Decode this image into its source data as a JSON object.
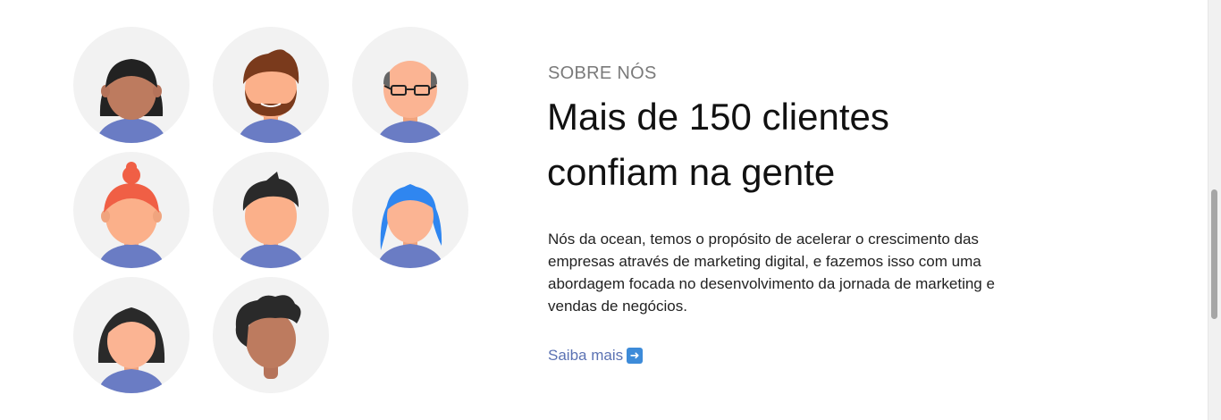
{
  "avatars": [
    {
      "name": "avatar-woman-black-bob"
    },
    {
      "name": "avatar-man-red-beard"
    },
    {
      "name": "avatar-man-bald-glasses"
    },
    {
      "name": "avatar-woman-red-bun"
    },
    {
      "name": "avatar-man-black-spiky"
    },
    {
      "name": "avatar-woman-blue-hair"
    },
    {
      "name": "avatar-woman-black-short"
    },
    {
      "name": "avatar-man-curly-dark"
    }
  ],
  "about": {
    "eyebrow": "SOBRE NÓS",
    "headline": "Mais de 150 clientes confiam na gente",
    "body": "Nós da ocean, temos o propósito de acelerar o crescimento das empresas através de marketing digital, e fazemos isso com uma abordagem focada no desenvolvimento da jornada de marketing e vendas de negócios.",
    "cta_label": "Saiba mais",
    "cta_icon": "arrow-right-icon"
  },
  "colors": {
    "accent": "#5b72b3",
    "shirt": "#6a7cc4",
    "avatar_bg": "#f2f2f2"
  }
}
